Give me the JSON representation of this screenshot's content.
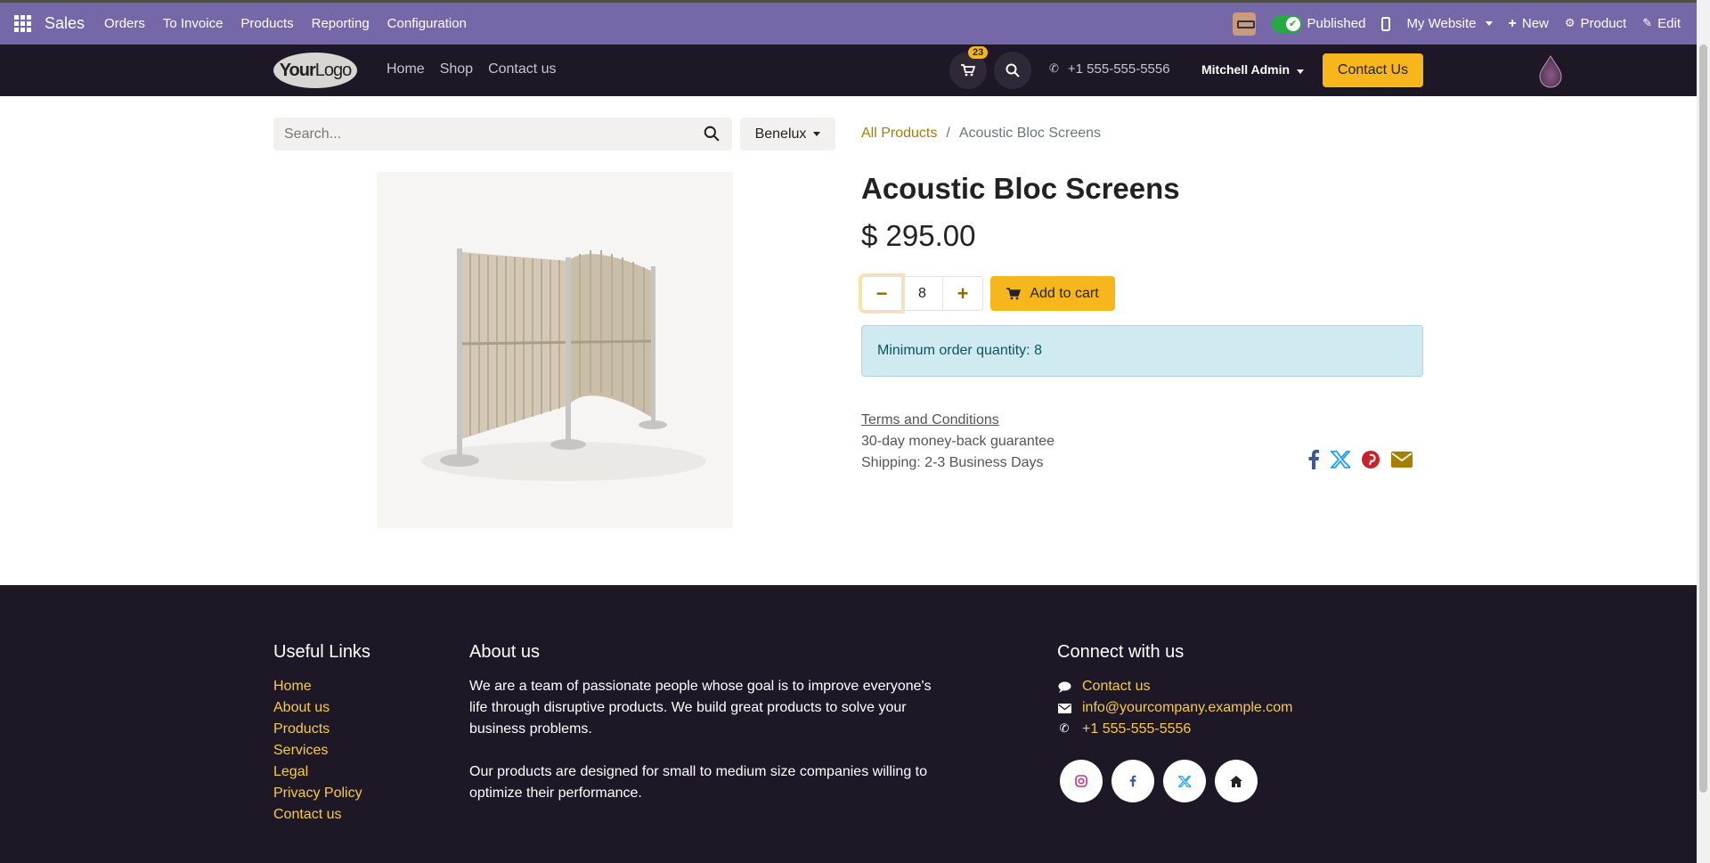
{
  "adminbar": {
    "app_name": "Sales",
    "menus": [
      "Orders",
      "To Invoice",
      "Products",
      "Reporting",
      "Configuration"
    ],
    "published_label": "Published",
    "website_label": "My Website",
    "new_label": "New",
    "product_label": "Product",
    "edit_label": "Edit"
  },
  "header": {
    "logo_bold": "Your",
    "logo_light": "Logo",
    "nav": [
      "Home",
      "Shop",
      "Contact us"
    ],
    "cart_count": "23",
    "phone": "+1 555-555-5556",
    "user": "Mitchell Admin",
    "contact_button": "Contact Us"
  },
  "shop": {
    "search_placeholder": "Search...",
    "pricelist": "Benelux"
  },
  "breadcrumb": {
    "parent": "All Products",
    "separator": "/",
    "current": "Acoustic Bloc Screens"
  },
  "product": {
    "name": "Acoustic Bloc Screens",
    "price": "$ 295.00",
    "quantity": "8",
    "add_to_cart": "Add to cart",
    "min_qty_notice": "Minimum order quantity: 8",
    "terms_link": "Terms and Conditions",
    "guarantee": "30-day money-back guarantee",
    "shipping": "Shipping: 2-3 Business Days"
  },
  "footer": {
    "useful_links_title": "Useful Links",
    "useful_links": [
      "Home",
      "About us",
      "Products",
      "Services",
      "Legal",
      "Privacy Policy",
      "Contact us"
    ],
    "about_title": "About us",
    "about_p1": "We are a team of passionate people whose goal is to improve everyone's life through disruptive products. We build great products to solve your business problems.",
    "about_p2": "Our products are designed for small to medium size companies willing to optimize their performance.",
    "connect_title": "Connect with us",
    "contact_link": "Contact us",
    "email": "info@yourcompany.example.com",
    "phone": "+1 555-555-5556"
  },
  "colors": {
    "adminbar_bg": "#7668a8",
    "site_dark": "#1e1826",
    "accent_yellow": "#f7b61c",
    "link_gold": "#a67e00",
    "alert_bg": "#cfeaf0"
  },
  "icons": {
    "apps": "apps-grid-icon",
    "cart": "cart-icon",
    "search": "search-icon",
    "phone": "phone-icon",
    "share": [
      "facebook-icon",
      "x-icon",
      "pinterest-icon",
      "email-icon"
    ],
    "social": [
      "instagram-icon",
      "facebook-icon",
      "x-icon",
      "home-icon"
    ]
  }
}
